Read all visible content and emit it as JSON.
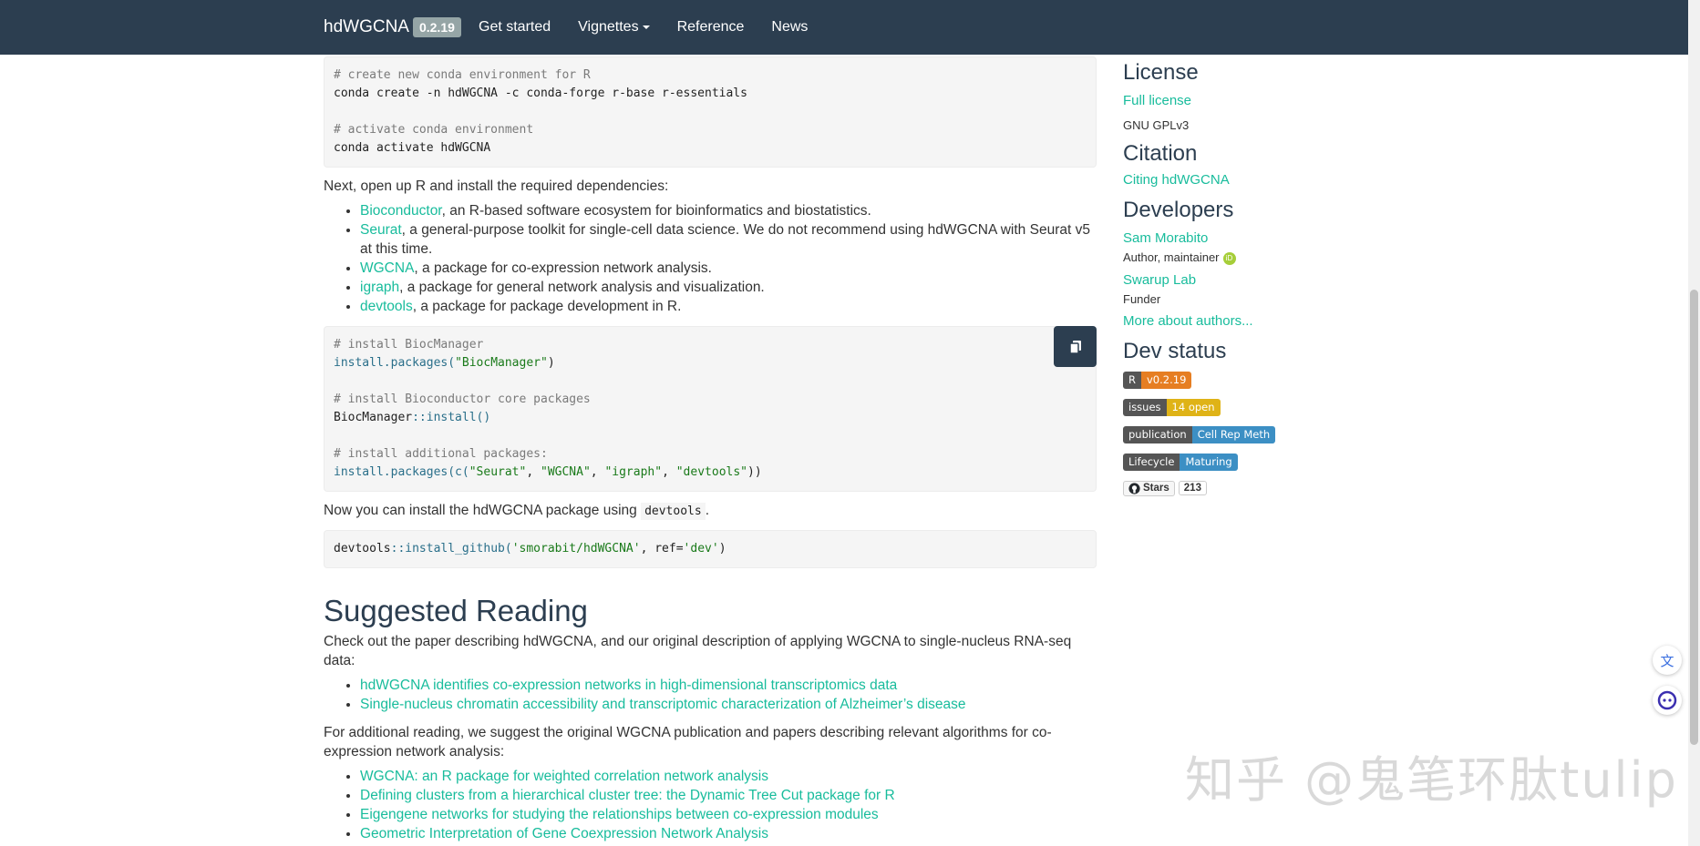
{
  "navbar": {
    "brand": "hdWGCNA",
    "version": "0.2.19",
    "items": [
      "Get started",
      "Vignettes",
      "Reference",
      "News"
    ]
  },
  "main": {
    "code1": {
      "comment1": "# create new conda environment for R",
      "line1": "conda create -n hdWGCNA -c conda-forge r-base r-essentials",
      "comment2": "# activate conda environment",
      "line2": "conda activate hdWGCNA"
    },
    "deps_intro": "Next, open up R and install the required dependencies:",
    "deps": [
      {
        "link": "Bioconductor",
        "text": ", an R-based software ecosystem for bioinformatics and biostatistics."
      },
      {
        "link": "Seurat",
        "text": ", a general-purpose toolkit for single-cell data science. We do not recommend using hdWGCNA with Seurat v5 at this time."
      },
      {
        "link": "WGCNA",
        "text": ", a package for co-expression network analysis."
      },
      {
        "link": "igraph",
        "text": ", a package for general network analysis and visualization."
      },
      {
        "link": "devtools",
        "text": ", a package for package development in R."
      }
    ],
    "code2": {
      "comment1": "# install BiocManager",
      "line1_fn": "install.packages(",
      "line1_str": "\"BiocManager\"",
      "line1_end": ")",
      "comment2": "# install Bioconductor core packages",
      "line2_a": "BiocManager",
      "line2_b": "::",
      "line2_c": "install()",
      "comment3": "# install additional packages:",
      "line3_fn": "install.packages(c(",
      "pkgs": [
        "\"Seurat\"",
        "\"WGCNA\"",
        "\"igraph\"",
        "\"devtools\""
      ],
      "line3_end": "))"
    },
    "install_intro": "Now you can install the hdWGCNA package using",
    "install_code": "devtools",
    "install_period": ".",
    "code3": {
      "a": "devtools",
      "b": "::",
      "c": "install_github(",
      "d": "'smorabit/hdWGCNA'",
      "e": ", ref=",
      "f": "'dev'",
      "g": ")"
    },
    "reading_heading": "Suggested Reading",
    "reading_intro": "Check out the paper describing hdWGCNA, and our original description of applying WGCNA to single-nucleus RNA-seq data:",
    "reading_links": [
      "hdWGCNA identifies co-expression networks in high-dimensional transcriptomics data",
      "Single-nucleus chromatin accessibility and transcriptomic characterization of Alzheimer’s disease"
    ],
    "additional_intro": "For additional reading, we suggest the original WGCNA publication and papers describing relevant algorithms for co-expression network analysis:",
    "additional_links": [
      "WGCNA: an R package for weighted correlation network analysis",
      "Defining clusters from a hierarchical cluster tree: the Dynamic Tree Cut package for R",
      "Eigengene networks for studying the relationships between co-expression modules",
      "Geometric Interpretation of Gene Coexpression Network Analysis"
    ]
  },
  "sidebar": {
    "license_heading": "License",
    "license_link": "Full license",
    "license_text": "GNU GPLv3",
    "citation_heading": "Citation",
    "citation_link": "Citing hdWGCNA",
    "developers_heading": "Developers",
    "dev1_name": "Sam Morabito",
    "dev1_role": "Author, maintainer",
    "dev2_name": "Swarup Lab",
    "dev2_role": "Funder",
    "more_authors": "More about authors...",
    "status_heading": "Dev status",
    "badges": [
      {
        "left": "R",
        "right": "v0.2.19",
        "color": "#e67e22"
      },
      {
        "left": "issues",
        "right": "14 open",
        "color": "#dfb317"
      },
      {
        "left": "publication",
        "right": "Cell Rep Meth",
        "color": "#3c8fc4"
      },
      {
        "left": "Lifecycle",
        "right": "Maturing",
        "color": "#3c8fc4"
      }
    ],
    "github_label": "Stars",
    "github_count": "213"
  },
  "watermark": "知乎 @鬼笔环肽tulip"
}
